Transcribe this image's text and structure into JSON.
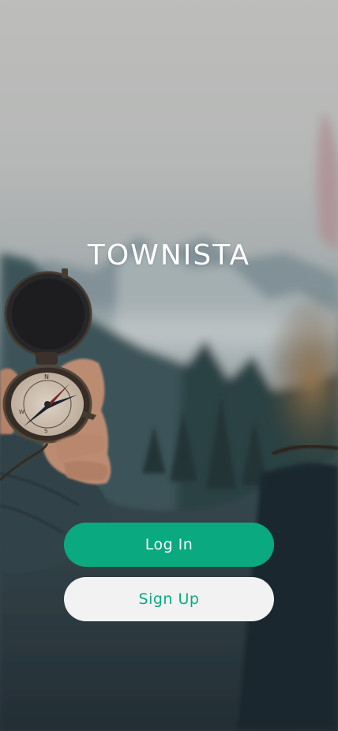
{
  "app": {
    "brand": "TOWNISTA"
  },
  "actions": {
    "login_label": "Log In",
    "signup_label": "Sign Up"
  },
  "colors": {
    "accent": "#0aa97f",
    "secondary_button_bg": "#f2f2f2",
    "brand_text": "#ffffff"
  },
  "background": {
    "subject": "hand-holding-compass-mountain-landscape"
  }
}
